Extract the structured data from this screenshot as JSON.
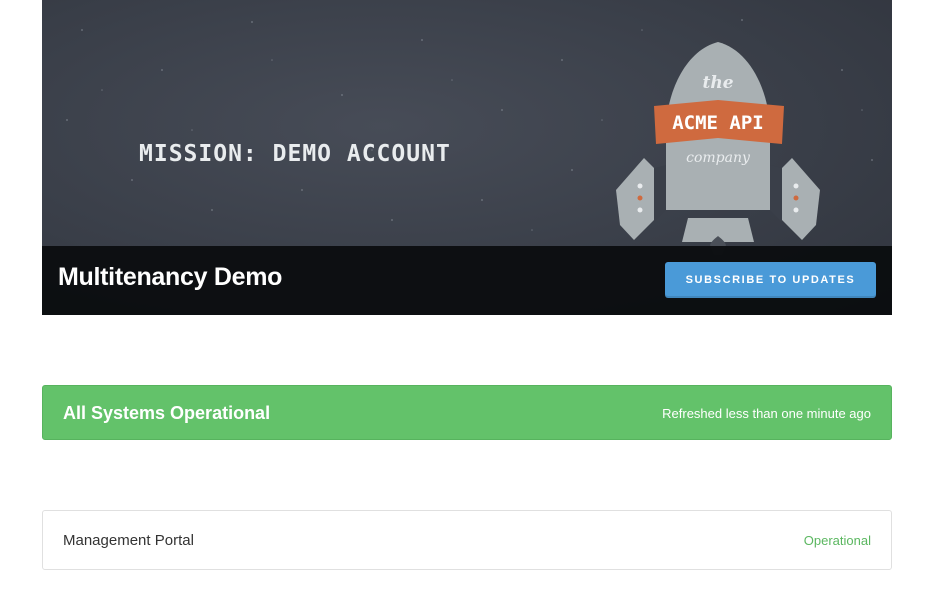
{
  "header": {
    "banner_text": "MISSION: DEMO ACCOUNT",
    "logo": {
      "line_top": "the",
      "line_middle": "ACME API",
      "line_bottom": "company"
    },
    "page_title": "Multitenancy Demo",
    "subscribe_label": "SUBSCRIBE TO UPDATES"
  },
  "status": {
    "title": "All Systems Operational",
    "refreshed": "Refreshed less than one minute ago",
    "color": "#63c26a"
  },
  "components": [
    {
      "name": "Management Portal",
      "status": "Operational",
      "status_color": "#5bb760"
    }
  ],
  "colors": {
    "hero_background": "#3a3f49",
    "subscribe_button": "#4a9ad8",
    "rocket_body": "#a9b0b3",
    "logo_ribbon": "#cf6a3f"
  }
}
